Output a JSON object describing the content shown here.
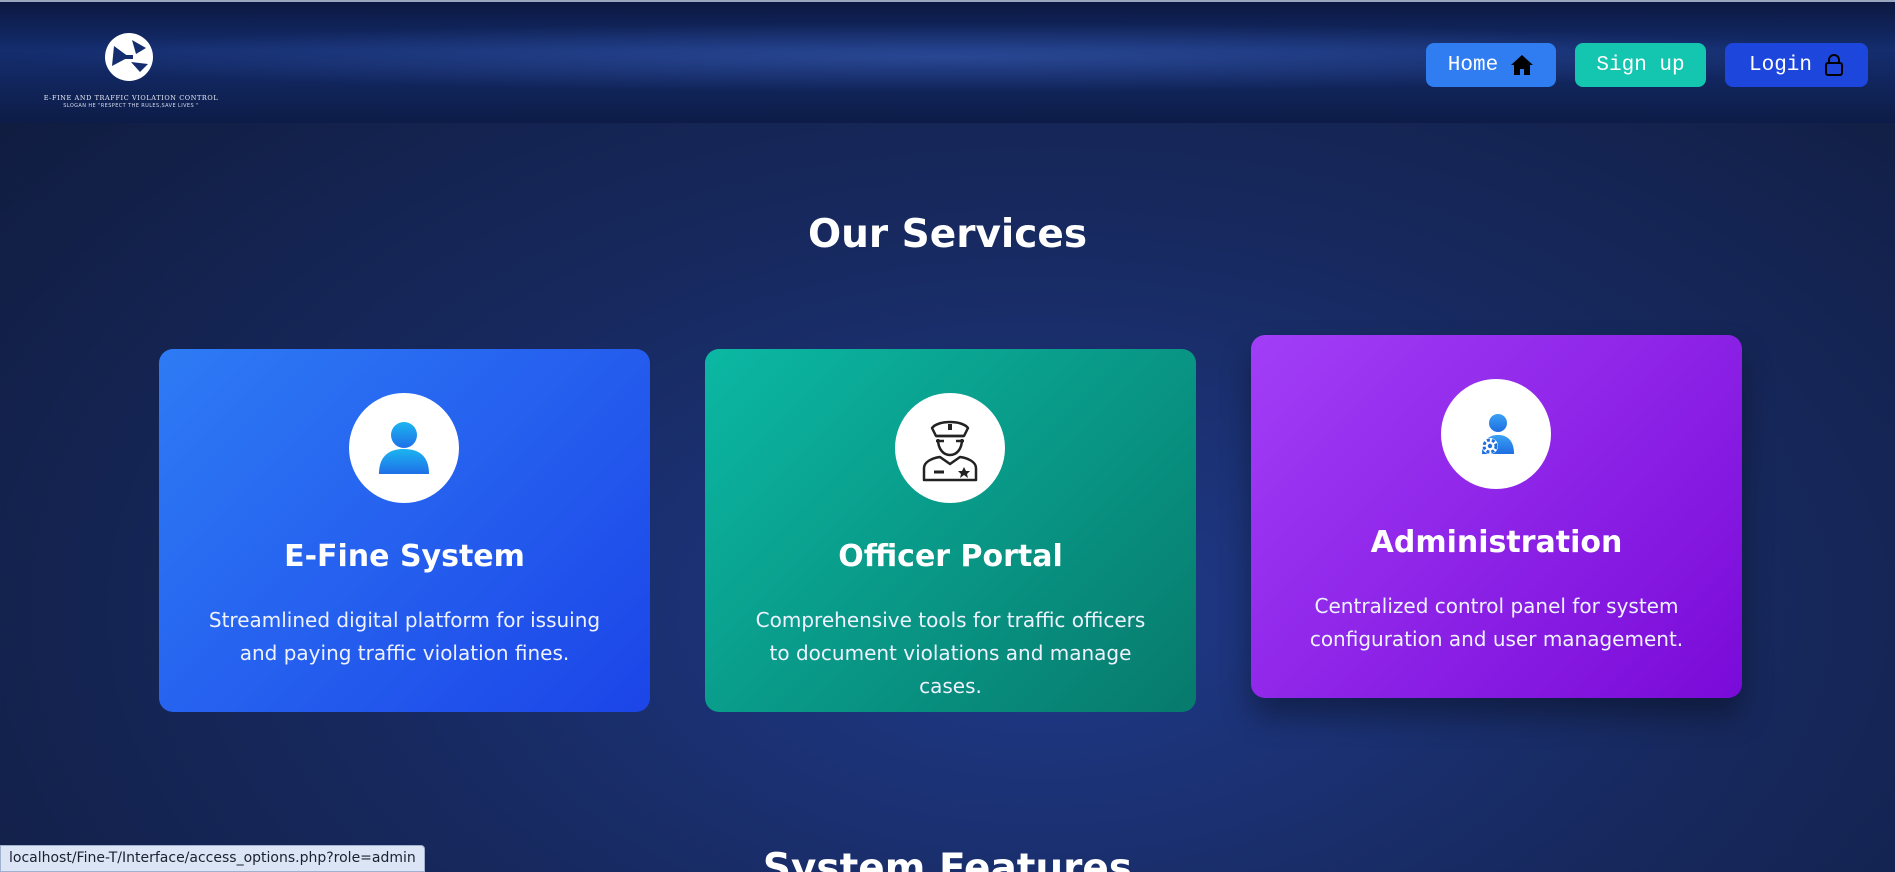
{
  "header": {
    "logo_title": "E-FINE AND TRAFFIC VIOLATION CONTROL",
    "logo_slogan": "SLOGAN HE \"RESPECT THE RULES,SAVE LIVES \"",
    "nav": {
      "home_label": "Home",
      "signup_label": "Sign up",
      "login_label": "Login"
    }
  },
  "services": {
    "title": "Our Services",
    "cards": [
      {
        "title": "E-Fine System",
        "description": "Streamlined digital platform for issuing and paying traffic violation fines.",
        "icon": "user-icon"
      },
      {
        "title": "Officer Portal",
        "description": "Comprehensive tools for traffic officers to document violations and manage cases.",
        "icon": "police-officer-icon"
      },
      {
        "title": "Administration",
        "description": "Centralized control panel for system configuration and user management.",
        "icon": "admin-gear-icon"
      }
    ]
  },
  "features": {
    "title": "System Features"
  },
  "status_bar": {
    "url": "localhost/Fine-T/Interface/access_options.php?role=admin"
  },
  "colors": {
    "home_button": "#2f7df0",
    "signup_button": "#14c5b0",
    "login_button": "#1c46dc",
    "card_blue": "#2e7bf5",
    "card_teal": "#0bb8a3",
    "card_purple": "#a23ef7"
  }
}
